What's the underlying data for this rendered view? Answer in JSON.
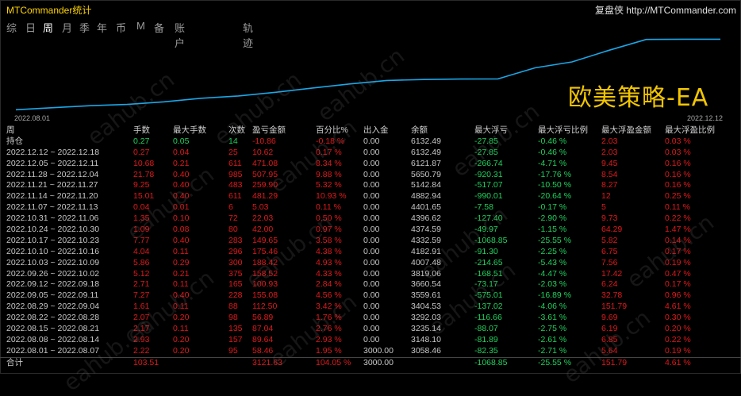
{
  "titlebar": {
    "app_title": "MTCommander统计",
    "site_label": "复盘侠 http://MTCommander.com"
  },
  "tabs": [
    "综",
    "日",
    "周",
    "月",
    "季",
    "年",
    "币",
    "M",
    "备",
    "账户",
    "轨迹"
  ],
  "active_tab": "周",
  "chart": {
    "overlay_title": "欧美策略-EA",
    "start_date": "2022.08.01",
    "end_date": "2022.12.12",
    "line_color": "#1aa7e8",
    "balance_series": [
      3058.46,
      3148.1,
      3235.14,
      3292.03,
      3404.53,
      3559.61,
      3660.54,
      3819.06,
      4007.48,
      4182.91,
      4332.59,
      4374.59,
      4396.62,
      4401.65,
      4882.94,
      5142.84,
      5650.79,
      6121.87,
      6132.49,
      6132.49
    ]
  },
  "table": {
    "headers": [
      "周",
      "手数",
      "最大手数",
      "次数",
      "盈亏金额",
      "百分比%",
      "出入金",
      "余额",
      "最大浮亏",
      "最大浮亏比例",
      "最大浮盈金额",
      "最大浮盈比例"
    ],
    "position_row": [
      "持仓",
      "0.27",
      "0.05",
      "14",
      "-10.86",
      "-0.18 %",
      "0.00",
      "6132.49",
      "-27.85",
      "-0.46 %",
      "2.03",
      "0.03 %"
    ],
    "rows": [
      [
        "2022.12.12 ~ 2022.12.18",
        "0.27",
        "0.04",
        "25",
        "10.62",
        "0.17 %",
        "0.00",
        "6132.49",
        "-27.85",
        "-0.46 %",
        "2.03",
        "0.03 %"
      ],
      [
        "2022.12.05 ~ 2022.12.11",
        "10.68",
        "0.21",
        "611",
        "471.08",
        "8.34 %",
        "0.00",
        "6121.87",
        "-266.74",
        "-4.71 %",
        "9.45",
        "0.16 %"
      ],
      [
        "2022.11.28 ~ 2022.12.04",
        "21.78",
        "0.40",
        "985",
        "507.95",
        "9.88 %",
        "0.00",
        "5650.79",
        "-920.31",
        "-17.76 %",
        "8.54",
        "0.16 %"
      ],
      [
        "2022.11.21 ~ 2022.11.27",
        "9.25",
        "0.40",
        "483",
        "259.90",
        "5.32 %",
        "0.00",
        "5142.84",
        "-517.07",
        "-10.50 %",
        "8.27",
        "0.16 %"
      ],
      [
        "2022.11.14 ~ 2022.11.20",
        "15.01",
        "0.40",
        "611",
        "481.29",
        "10.93 %",
        "0.00",
        "4882.94",
        "-990.01",
        "-20.64 %",
        "12",
        "0.25 %"
      ],
      [
        "2022.11.07 ~ 2022.11.13",
        "0.04",
        "0.01",
        "6",
        "5.03",
        "0.11 %",
        "0.00",
        "4401.65",
        "-7.58",
        "-0.17 %",
        "5",
        "0.11 %"
      ],
      [
        "2022.10.31 ~ 2022.11.06",
        "1.35",
        "0.10",
        "72",
        "22.03",
        "0.50 %",
        "0.00",
        "4396.62",
        "-127.40",
        "-2.90 %",
        "9.73",
        "0.22 %"
      ],
      [
        "2022.10.24 ~ 2022.10.30",
        "1.09",
        "0.08",
        "80",
        "42.00",
        "0.97 %",
        "0.00",
        "4374.59",
        "-49.97",
        "-1.15 %",
        "64.29",
        "1.47 %"
      ],
      [
        "2022.10.17 ~ 2022.10.23",
        "7.77",
        "0.40",
        "283",
        "149.65",
        "3.58 %",
        "0.00",
        "4332.59",
        "-1068.85",
        "-25.55 %",
        "5.82",
        "0.14 %"
      ],
      [
        "2022.10.10 ~ 2022.10.16",
        "4.04",
        "0.11",
        "296",
        "175.46",
        "4.38 %",
        "0.00",
        "4182.91",
        "-91.30",
        "-2.25 %",
        "6.75",
        "0.17 %"
      ],
      [
        "2022.10.03 ~ 2022.10.09",
        "5.86",
        "0.29",
        "300",
        "188.42",
        "4.93 %",
        "0.00",
        "4007.48",
        "-214.65",
        "-5.43 %",
        "7.56",
        "0.19 %"
      ],
      [
        "2022.09.26 ~ 2022.10.02",
        "5.12",
        "0.21",
        "375",
        "158.52",
        "4.33 %",
        "0.00",
        "3819.06",
        "-168.51",
        "-4.47 %",
        "17.42",
        "0.47 %"
      ],
      [
        "2022.09.12 ~ 2022.09.18",
        "2.71",
        "0.11",
        "165",
        "100.93",
        "2.84 %",
        "0.00",
        "3660.54",
        "-73.17",
        "-2.03 %",
        "6.24",
        "0.17 %"
      ],
      [
        "2022.09.05 ~ 2022.09.11",
        "7.27",
        "0.40",
        "228",
        "155.08",
        "4.56 %",
        "0.00",
        "3559.61",
        "-575.01",
        "-16.89 %",
        "32.78",
        "0.96 %"
      ],
      [
        "2022.08.29 ~ 2022.09.04",
        "1.61",
        "0.11",
        "88",
        "112.50",
        "3.42 %",
        "0.00",
        "3404.53",
        "-137.02",
        "-4.06 %",
        "151.79",
        "4.61 %"
      ],
      [
        "2022.08.22 ~ 2022.08.28",
        "2.07",
        "0.20",
        "98",
        "56.89",
        "1.76 %",
        "0.00",
        "3292.03",
        "-116.66",
        "-3.61 %",
        "9.69",
        "0.30 %"
      ],
      [
        "2022.08.15 ~ 2022.08.21",
        "2.17",
        "0.11",
        "135",
        "87.04",
        "2.76 %",
        "0.00",
        "3235.14",
        "-88.07",
        "-2.75 %",
        "6.19",
        "0.20 %"
      ],
      [
        "2022.08.08 ~ 2022.08.14",
        "2.93",
        "0.20",
        "157",
        "89.64",
        "2.93 %",
        "0.00",
        "3148.10",
        "-81.89",
        "-2.61 %",
        "6.85",
        "0.22 %"
      ],
      [
        "2022.08.01 ~ 2022.08.07",
        "2.22",
        "0.20",
        "95",
        "58.46",
        "1.95 %",
        "3000.00",
        "3058.46",
        "-82.35",
        "-2.71 %",
        "5.64",
        "0.19 %"
      ]
    ],
    "total_row": [
      "合计",
      "103.51",
      "",
      "",
      "3121.63",
      "104.05 %",
      "3000.00",
      "",
      "-1068.85",
      "-25.55 %",
      "151.79",
      "4.61 %"
    ]
  },
  "colors": {
    "profit": "#e0191b",
    "loss": "#1fd15c",
    "title": "#ffd400",
    "accent_text": "#f2c500"
  },
  "watermarks": [
    "eahub.cn"
  ]
}
